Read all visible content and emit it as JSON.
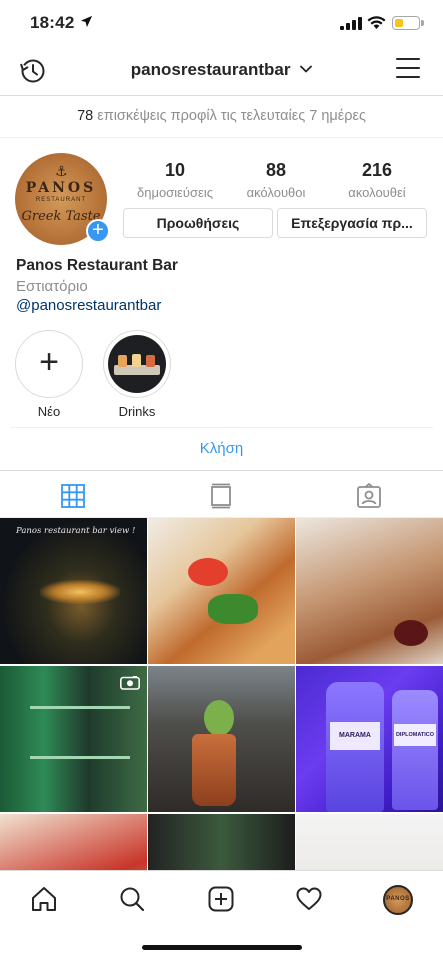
{
  "status_bar": {
    "time": "18:42",
    "battery_level": 0.35,
    "battery_color": "#f5c518"
  },
  "header": {
    "username": "panosrestaurantbar",
    "left_icon": "history-icon",
    "dropdown_icon": "chevron-down-icon",
    "right_icon": "menu-icon"
  },
  "insights": {
    "count": "78",
    "text": "επισκέψεις προφίλ τις τελευταίες 7 ημέρες"
  },
  "profile": {
    "avatar": {
      "logo_line1": "PANOS",
      "logo_line2": "RESTAURANT",
      "logo_line3": "Greek Taste"
    },
    "stats": [
      {
        "value": "10",
        "label": "δημοσιεύσεις"
      },
      {
        "value": "88",
        "label": "ακόλουθοι"
      },
      {
        "value": "216",
        "label": "ακολουθεί"
      }
    ],
    "buttons": {
      "promote": "Προωθήσεις",
      "edit": "Επεξεργασία πρ..."
    },
    "name": "Panos Restaurant Bar",
    "category": "Εστιατόριο",
    "handle": "@panosrestaurantbar"
  },
  "highlights": [
    {
      "label": "Νέο",
      "icon": "plus-icon"
    },
    {
      "label": "Drinks"
    }
  ],
  "call_button": "Κλήση",
  "tabs": [
    {
      "name": "grid",
      "icon": "grid-icon",
      "active": true
    },
    {
      "name": "feed",
      "icon": "feed-icon",
      "active": false
    },
    {
      "name": "tagged",
      "icon": "tagged-icon",
      "active": false
    }
  ],
  "grid": {
    "post1_caption": "Panos restaurant bar view !",
    "post6_label1": "MARAMA",
    "post6_label2": "DIPLOMATICO"
  },
  "bottom_nav": {
    "items": [
      "home-icon",
      "search-icon",
      "new-post-icon",
      "activity-icon",
      "profile-avatar"
    ],
    "avatar_text": "PANOS"
  },
  "colors": {
    "accent_blue": "#3897f0",
    "link_dark_blue": "#003569",
    "muted_grey": "#8e8e8e",
    "text": "#262626"
  }
}
